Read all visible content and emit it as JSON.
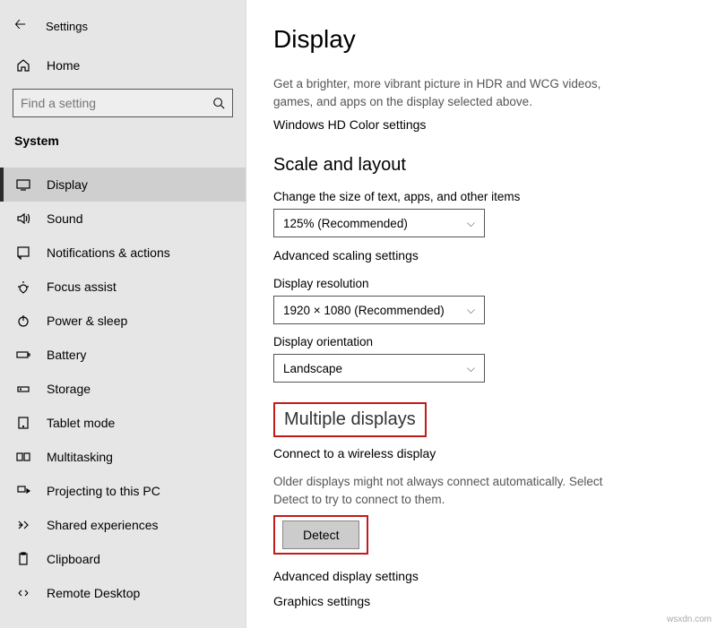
{
  "header": {
    "back_glyph": "🡠",
    "title": "Settings"
  },
  "home": {
    "label": "Home"
  },
  "search": {
    "placeholder": "Find a setting"
  },
  "category": "System",
  "nav": [
    {
      "label": "Display"
    },
    {
      "label": "Sound"
    },
    {
      "label": "Notifications & actions"
    },
    {
      "label": "Focus assist"
    },
    {
      "label": "Power & sleep"
    },
    {
      "label": "Battery"
    },
    {
      "label": "Storage"
    },
    {
      "label": "Tablet mode"
    },
    {
      "label": "Multitasking"
    },
    {
      "label": "Projecting to this PC"
    },
    {
      "label": "Shared experiences"
    },
    {
      "label": "Clipboard"
    },
    {
      "label": "Remote Desktop"
    }
  ],
  "page": {
    "title": "Display",
    "hdr_desc": "Get a brighter, more vibrant picture in HDR and WCG videos, games, and apps on the display selected above.",
    "hdr_link": "Windows HD Color settings",
    "scale_heading": "Scale and layout",
    "scale_label": "Change the size of text, apps, and other items",
    "scale_value": "125% (Recommended)",
    "adv_scale_link": "Advanced scaling settings",
    "res_label": "Display resolution",
    "res_value": "1920 × 1080 (Recommended)",
    "orient_label": "Display orientation",
    "orient_value": "Landscape",
    "multi_heading": "Multiple displays",
    "wireless_link": "Connect to a wireless display",
    "older_desc": "Older displays might not always connect automatically. Select Detect to try to connect to them.",
    "detect_btn": "Detect",
    "adv_display_link": "Advanced display settings",
    "graphics_link": "Graphics settings"
  },
  "watermark": "wsxdn.com"
}
